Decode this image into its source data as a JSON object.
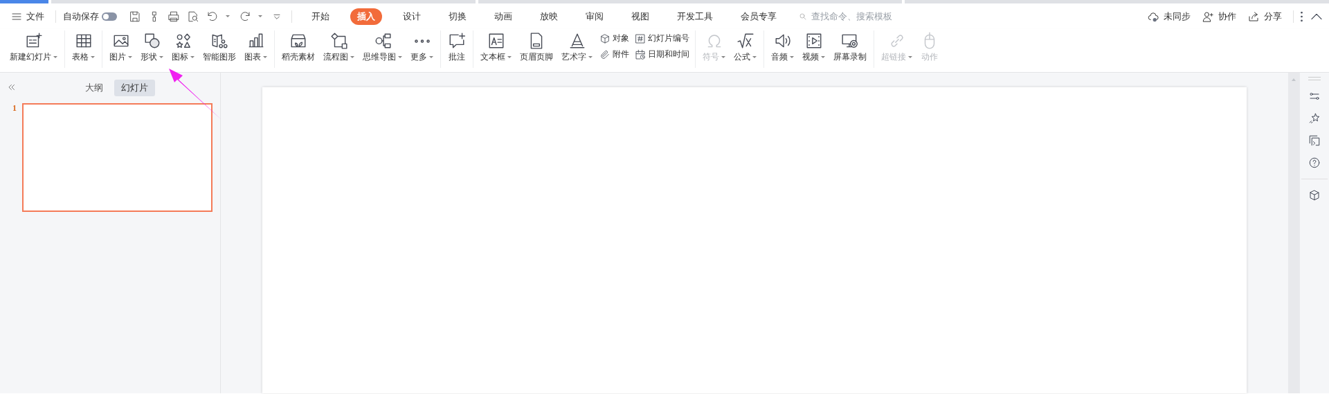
{
  "menu": {
    "file": "文件",
    "autosave": {
      "label": "自动保存",
      "on": false
    }
  },
  "tabs": [
    {
      "label": "开始",
      "selected": false
    },
    {
      "label": "插入",
      "selected": true
    },
    {
      "label": "设计",
      "selected": false
    },
    {
      "label": "切换",
      "selected": false
    },
    {
      "label": "动画",
      "selected": false
    },
    {
      "label": "放映",
      "selected": false
    },
    {
      "label": "审阅",
      "selected": false
    },
    {
      "label": "视图",
      "selected": false
    },
    {
      "label": "开发工具",
      "selected": false
    },
    {
      "label": "会员专享",
      "selected": false
    }
  ],
  "search": {
    "placeholder": "查找命令、搜索模板"
  },
  "actions": [
    "未同步",
    "协作",
    "分享"
  ],
  "ribbon": [
    {
      "items": [
        {
          "kind": "large",
          "label": "新建幻灯片",
          "dropdown": true,
          "disabled": false
        }
      ]
    },
    {
      "items": [
        {
          "kind": "large",
          "label": "表格",
          "dropdown": true,
          "disabled": false
        }
      ]
    },
    {
      "items": [
        {
          "kind": "large",
          "label": "图片",
          "dropdown": true,
          "disabled": false
        },
        {
          "kind": "large",
          "label": "形状",
          "dropdown": true,
          "disabled": false
        },
        {
          "kind": "large",
          "label": "图标",
          "dropdown": true,
          "disabled": false
        },
        {
          "kind": "large",
          "label": "智能图形",
          "dropdown": false,
          "disabled": false
        },
        {
          "kind": "large",
          "label": "图表",
          "dropdown": true,
          "disabled": false
        }
      ]
    },
    {
      "items": [
        {
          "kind": "large",
          "label": "稻壳素材",
          "dropdown": false,
          "disabled": false
        },
        {
          "kind": "large",
          "label": "流程图",
          "dropdown": true,
          "disabled": false
        },
        {
          "kind": "large",
          "label": "思维导图",
          "dropdown": true,
          "disabled": false
        },
        {
          "kind": "large",
          "label": "更多",
          "dropdown": true,
          "disabled": false
        }
      ]
    },
    {
      "items": [
        {
          "kind": "large",
          "label": "批注",
          "dropdown": false,
          "disabled": false
        }
      ]
    },
    {
      "items": [
        {
          "kind": "large",
          "label": "文本框",
          "dropdown": true,
          "disabled": false
        },
        {
          "kind": "large",
          "label": "页眉页脚",
          "dropdown": false,
          "disabled": false
        },
        {
          "kind": "large",
          "label": "艺术字",
          "dropdown": true,
          "disabled": false
        },
        {
          "kind": "stack",
          "items": [
            {
              "label": "对象"
            },
            {
              "label": "附件"
            }
          ]
        },
        {
          "kind": "stack",
          "items": [
            {
              "label": "幻灯片编号"
            },
            {
              "label": "日期和时间"
            }
          ]
        }
      ]
    },
    {
      "items": [
        {
          "kind": "large",
          "label": "符号",
          "dropdown": true,
          "disabled": true
        },
        {
          "kind": "large",
          "label": "公式",
          "dropdown": true,
          "disabled": false
        }
      ]
    },
    {
      "items": [
        {
          "kind": "large",
          "label": "音频",
          "dropdown": true,
          "disabled": false
        },
        {
          "kind": "large",
          "label": "视频",
          "dropdown": true,
          "disabled": false
        },
        {
          "kind": "large",
          "label": "屏幕录制",
          "dropdown": false,
          "disabled": false
        }
      ]
    },
    {
      "items": [
        {
          "kind": "large",
          "label": "超链接",
          "dropdown": true,
          "disabled": true
        },
        {
          "kind": "large",
          "label": "动作",
          "dropdown": false,
          "disabled": true
        }
      ]
    }
  ],
  "panel": {
    "tabs": [
      {
        "label": "大纲",
        "selected": false
      },
      {
        "label": "幻灯片",
        "selected": true
      }
    ],
    "slides": [
      {
        "number": "1",
        "selected": true
      }
    ]
  }
}
